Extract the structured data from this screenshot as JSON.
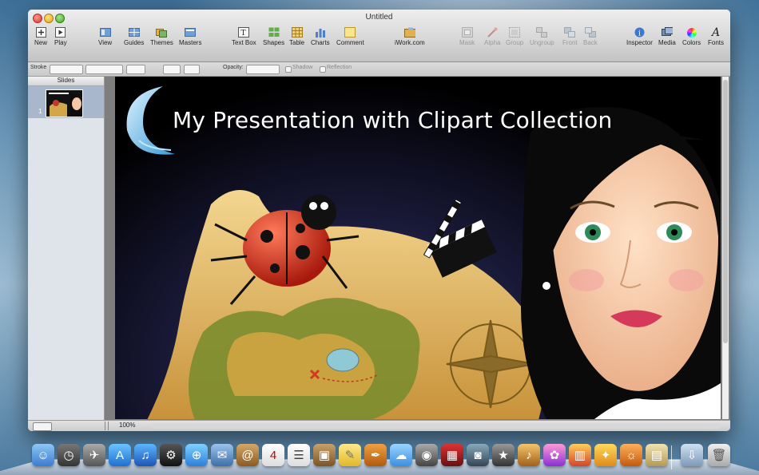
{
  "window": {
    "title": "Untitled"
  },
  "toolbar": {
    "new": "New",
    "play": "Play",
    "view": "View",
    "guides": "Guides",
    "themes": "Themes",
    "masters": "Masters",
    "text_box": "Text Box",
    "shapes": "Shapes",
    "table": "Table",
    "charts": "Charts",
    "comment": "Comment",
    "iwork": "iWork.com",
    "mask": "Mask",
    "alpha": "Alpha",
    "group": "Group",
    "ungroup": "Ungroup",
    "front": "Front",
    "back": "Back",
    "inspector": "Inspector",
    "media": "Media",
    "colors": "Colors",
    "fonts": "Fonts"
  },
  "formatbar": {
    "stroke": "Stroke",
    "opacity": "Opacity:",
    "shadow": "Shadow",
    "reflection": "Reflection"
  },
  "sidebar": {
    "header": "Slides",
    "slide_number": "1"
  },
  "slide": {
    "title": "My Presentation with Clipart Collection"
  },
  "bottombar": {
    "zoom": "100%"
  },
  "colors": {
    "slide_bg": "#000000",
    "selection": "#a9b7cc"
  }
}
